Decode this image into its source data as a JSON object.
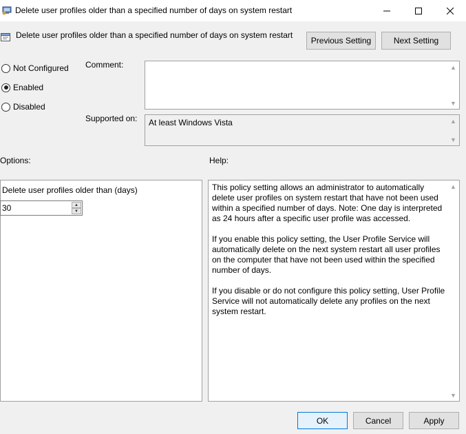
{
  "window": {
    "title": "Delete user profiles older than a specified number of days on system restart"
  },
  "header": {
    "policy_title": "Delete user profiles older than a specified number of days on system restart",
    "previous_label": "Previous Setting",
    "next_label": "Next Setting"
  },
  "state": {
    "options": [
      {
        "label": "Not Configured",
        "checked": false
      },
      {
        "label": "Enabled",
        "checked": true
      },
      {
        "label": "Disabled",
        "checked": false
      }
    ]
  },
  "comment": {
    "label": "Comment:",
    "value": ""
  },
  "supported": {
    "label": "Supported on:",
    "value": "At least Windows Vista"
  },
  "options_section": {
    "heading": "Options:",
    "field_label": "Delete user profiles older than (days)",
    "field_value": "30"
  },
  "help_section": {
    "heading": "Help:",
    "paragraphs": [
      "This policy setting allows an administrator to automatically delete user profiles on system restart that have not been used within a specified number of days. Note: One day is interpreted as 24 hours after a specific user profile was accessed.",
      "If you enable this policy setting, the User Profile Service will automatically delete on the next system restart all user profiles on the computer that have not been used within the specified number of days.",
      "If you disable or do not configure this policy setting, User Profile Service will not automatically delete any profiles on the next system restart."
    ]
  },
  "footer": {
    "ok_label": "OK",
    "cancel_label": "Cancel",
    "apply_label": "Apply"
  },
  "icons": {
    "window_icon": "group-policy-icon",
    "policy_icon": "policy-setting-icon"
  }
}
